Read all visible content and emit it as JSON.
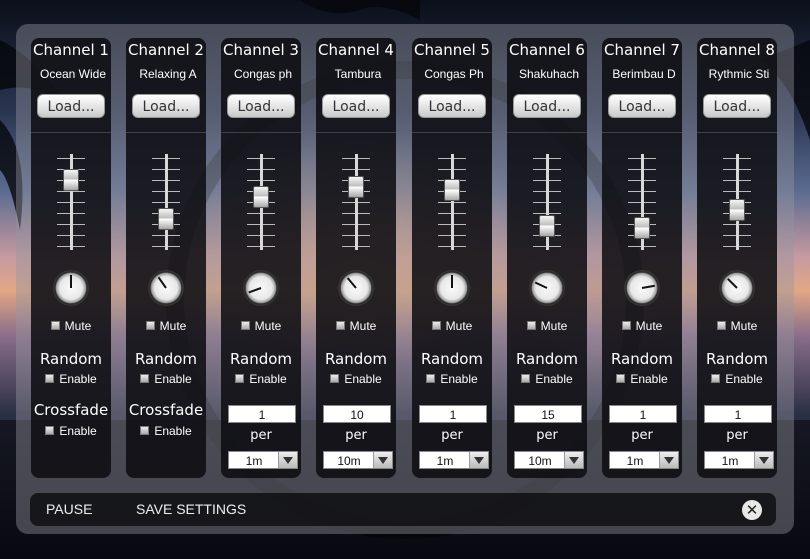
{
  "channels": [
    {
      "title": "Channel 1",
      "file": "Ocean Wide",
      "load_label": "Load...",
      "fader": 0.78,
      "knob_deg": 0,
      "mute_label": "Mute",
      "random_title": "Random",
      "random_enable": "Enable",
      "crossfade_title": "Crossfade",
      "crossfade_enable": "Enable"
    },
    {
      "title": "Channel 2",
      "file": "Relaxing A",
      "load_label": "Load...",
      "fader": 0.38,
      "knob_deg": -35,
      "mute_label": "Mute",
      "random_title": "Random",
      "random_enable": "Enable",
      "crossfade_title": "Crossfade",
      "crossfade_enable": "Enable"
    },
    {
      "title": "Channel 3",
      "file": "Congas ph",
      "load_label": "Load...",
      "fader": 0.6,
      "knob_deg": -110,
      "mute_label": "Mute",
      "random_title": "Random",
      "random_enable": "Enable",
      "count": "1",
      "per_label": "per",
      "interval": "1m"
    },
    {
      "title": "Channel 4",
      "file": "Tambura",
      "load_label": "Load...",
      "fader": 0.71,
      "knob_deg": -40,
      "mute_label": "Mute",
      "random_title": "Random",
      "random_enable": "Enable",
      "count": "10",
      "per_label": "per",
      "interval": "10m"
    },
    {
      "title": "Channel 5",
      "file": "Congas Ph",
      "load_label": "Load...",
      "fader": 0.68,
      "knob_deg": 0,
      "mute_label": "Mute",
      "random_title": "Random",
      "random_enable": "Enable",
      "count": "1",
      "per_label": "per",
      "interval": "1m"
    },
    {
      "title": "Channel 6",
      "file": "Shakuhach",
      "load_label": "Load...",
      "fader": 0.3,
      "knob_deg": -65,
      "mute_label": "Mute",
      "random_title": "Random",
      "random_enable": "Enable",
      "count": "15",
      "per_label": "per",
      "interval": "10m"
    },
    {
      "title": "Channel 7",
      "file": "Berimbau D",
      "load_label": "Load...",
      "fader": 0.28,
      "knob_deg": 80,
      "mute_label": "Mute",
      "random_title": "Random",
      "random_enable": "Enable",
      "count": "1",
      "per_label": "per",
      "interval": "1m"
    },
    {
      "title": "Channel 8",
      "file": "Rythmic Sti",
      "load_label": "Load...",
      "fader": 0.47,
      "knob_deg": -45,
      "mute_label": "Mute",
      "random_title": "Random",
      "random_enable": "Enable",
      "count": "1",
      "per_label": "per",
      "interval": "1m"
    }
  ],
  "bottom_bar": {
    "pause_label": "PAUSE",
    "save_label": "SAVE SETTINGS",
    "close_symbol": "✕"
  },
  "icons": {
    "close": "close-icon",
    "fader": "fader-thumb",
    "knob": "volume-knob"
  }
}
